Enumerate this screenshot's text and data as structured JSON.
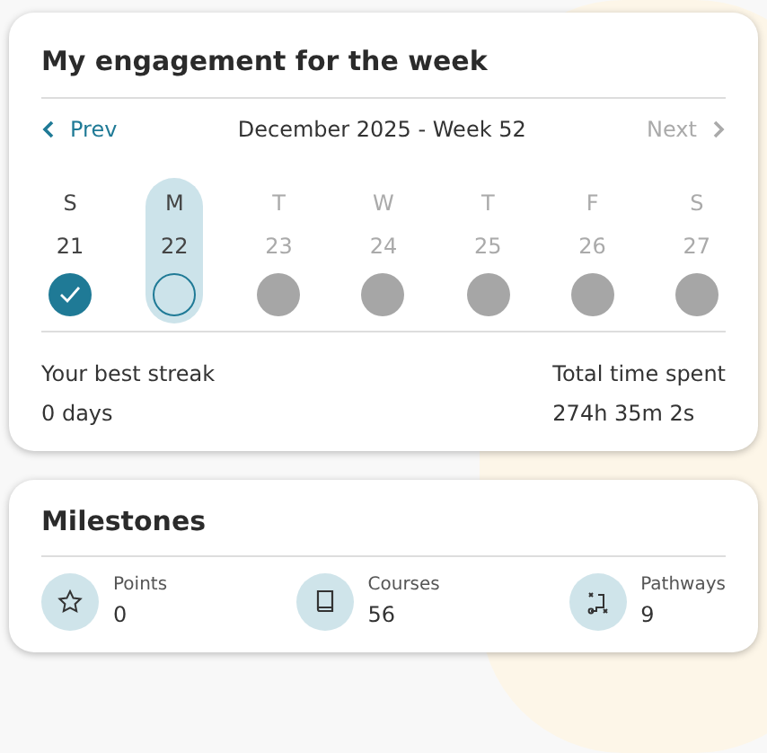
{
  "engagement": {
    "title": "My engagement for the week",
    "prev": {
      "label": "Prev",
      "disabled": false
    },
    "period": "December 2025 - Week 52",
    "next": {
      "label": "Next",
      "disabled": true
    },
    "days": [
      {
        "letter": "S",
        "date": "21",
        "selected": false,
        "kind": "done"
      },
      {
        "letter": "M",
        "date": "22",
        "selected": true,
        "kind": "open"
      },
      {
        "letter": "T",
        "date": "23",
        "selected": false,
        "kind": "future"
      },
      {
        "letter": "W",
        "date": "24",
        "selected": false,
        "kind": "future"
      },
      {
        "letter": "T",
        "date": "25",
        "selected": false,
        "kind": "future"
      },
      {
        "letter": "F",
        "date": "26",
        "selected": false,
        "kind": "future"
      },
      {
        "letter": "S",
        "date": "27",
        "selected": false,
        "kind": "future"
      }
    ],
    "stats": [
      {
        "label": "Your best streak",
        "value": "0 days"
      },
      {
        "label": "Total time spent",
        "value": "274h 35m 2s"
      }
    ]
  },
  "milestones": {
    "title": "Milestones",
    "items": [
      {
        "kind": "star",
        "label": "Points",
        "value": "0"
      },
      {
        "kind": "book",
        "label": "Courses",
        "value": "56"
      },
      {
        "kind": "route",
        "label": "Pathways",
        "value": "9"
      }
    ]
  }
}
